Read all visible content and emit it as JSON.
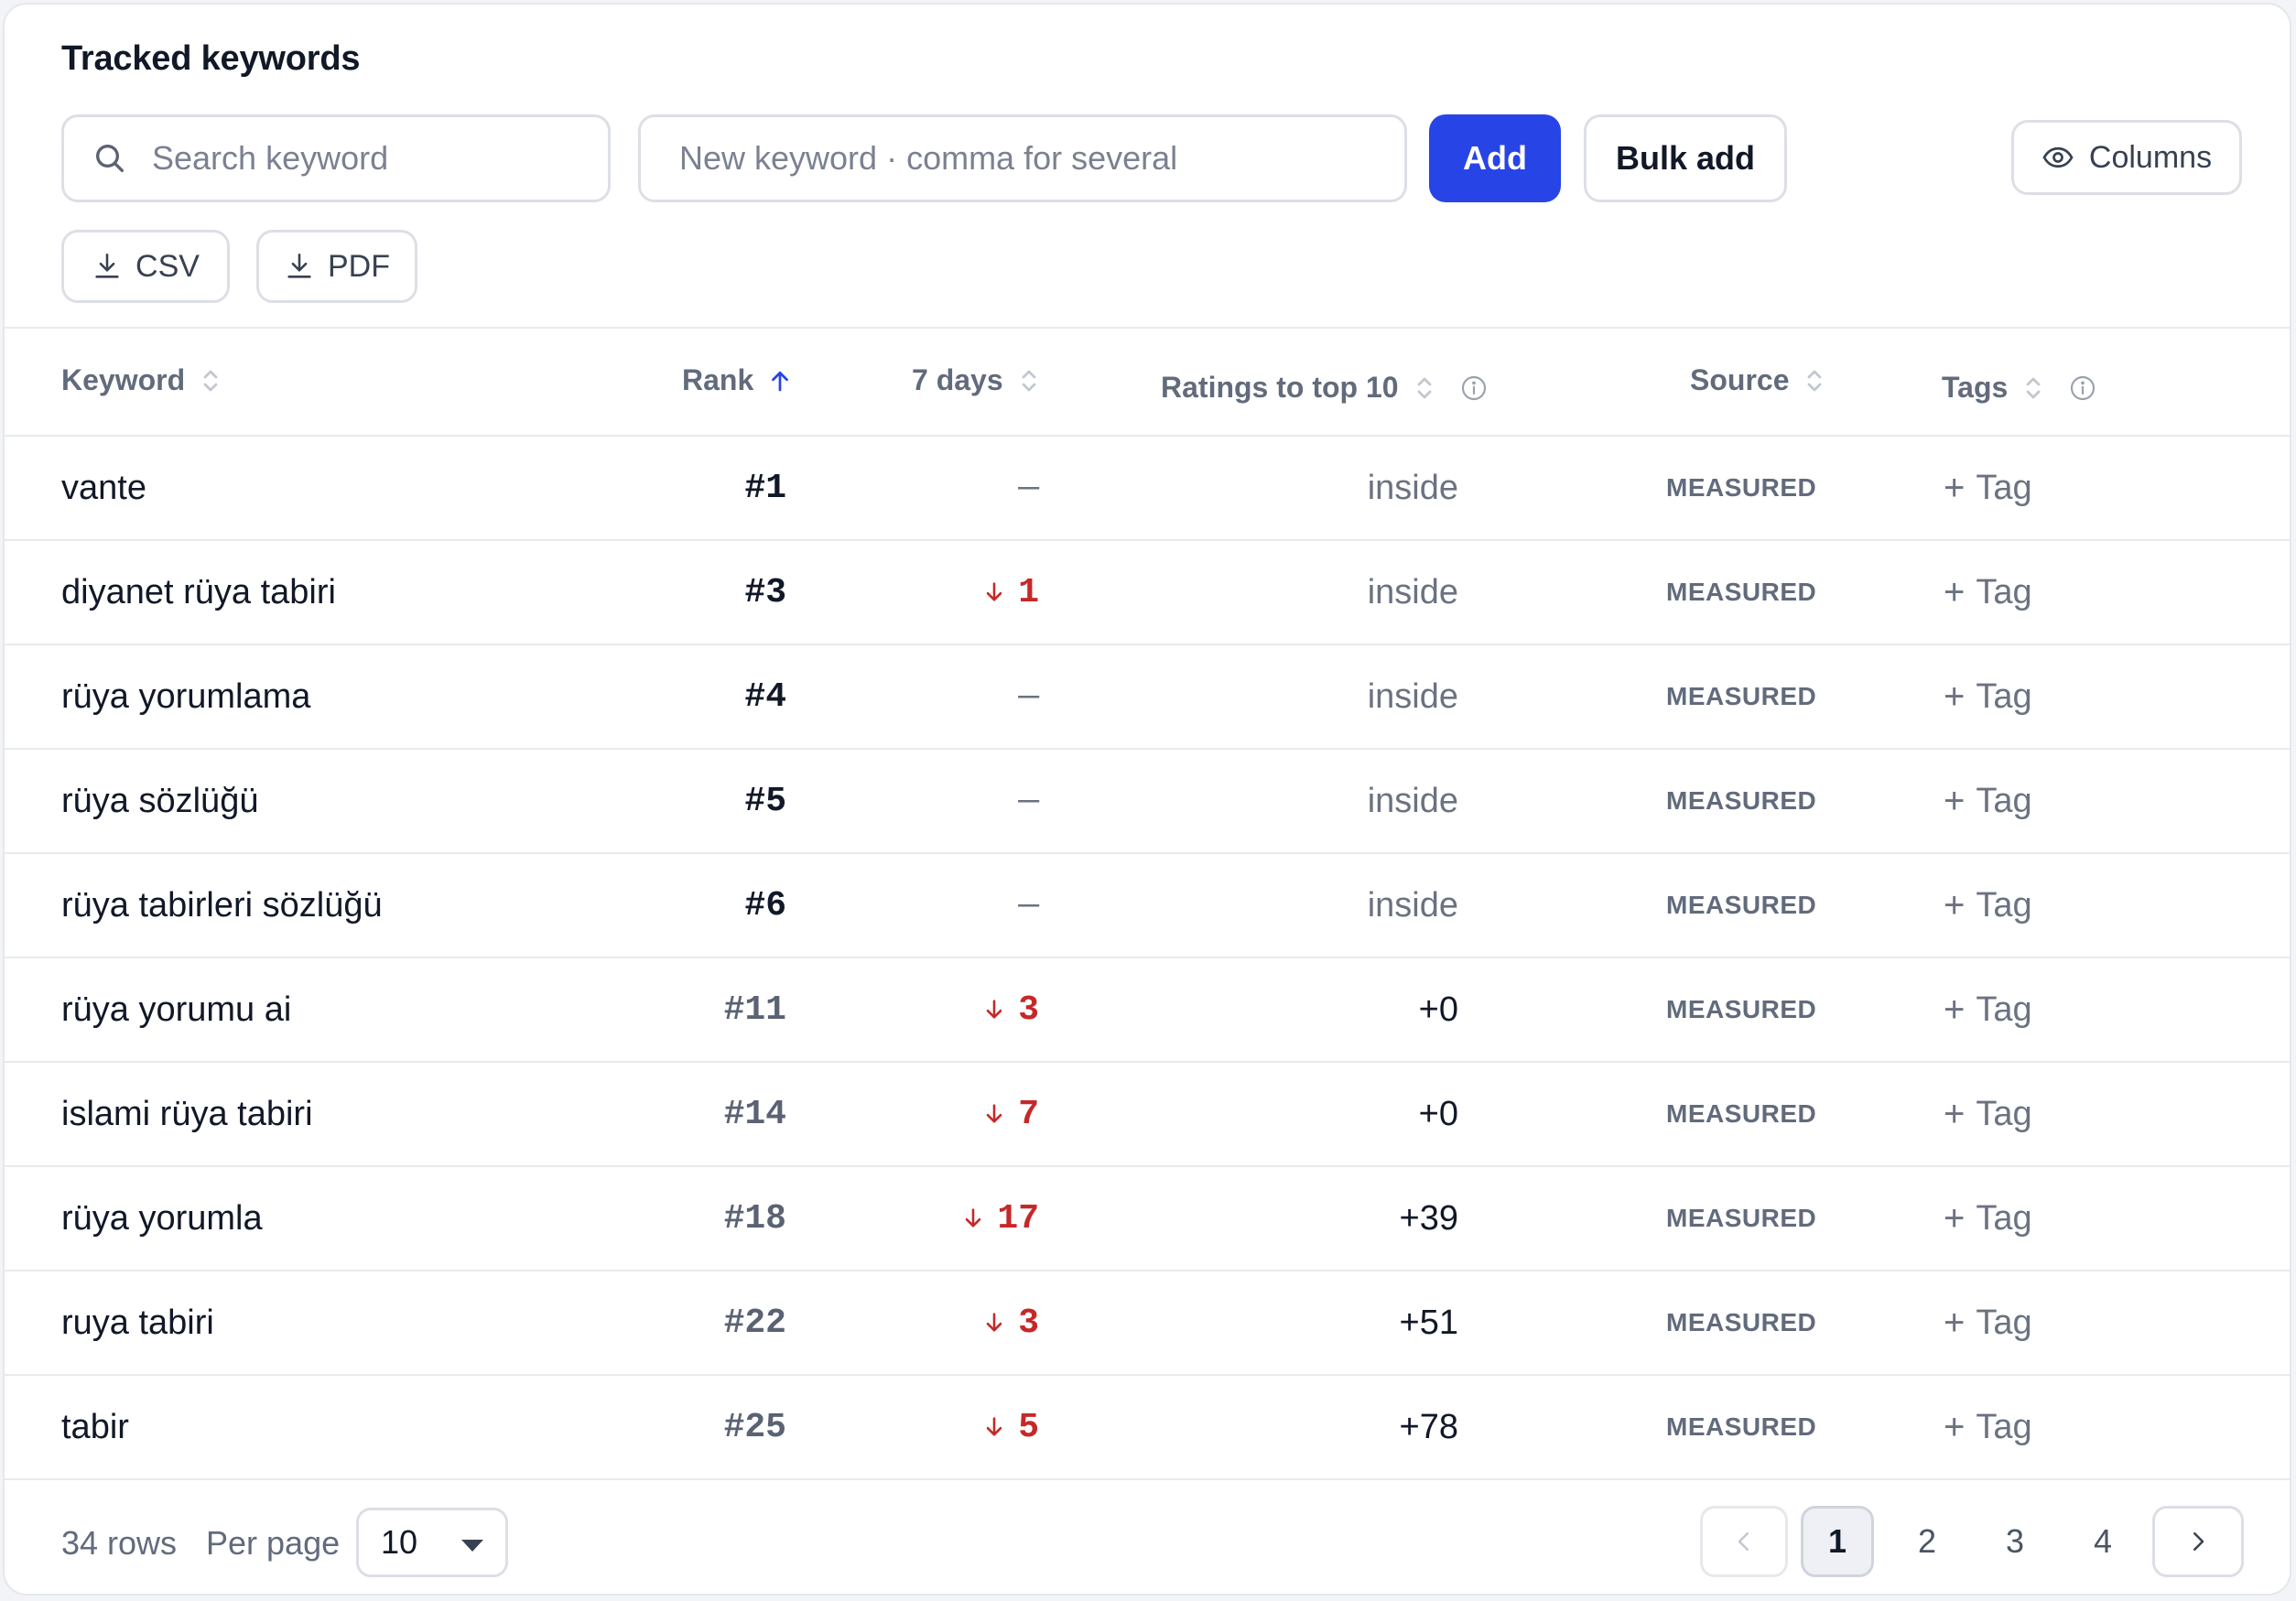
{
  "title": "Tracked keywords",
  "search": {
    "placeholder": "Search keyword"
  },
  "new_keyword": {
    "placeholder": "New keyword · comma for several"
  },
  "buttons": {
    "add": "Add",
    "bulk_add": "Bulk add",
    "columns": "Columns",
    "csv": "CSV",
    "pdf": "PDF"
  },
  "table": {
    "headers": {
      "keyword": "Keyword",
      "rank": "Rank",
      "days": "7 days",
      "ratings": "Ratings to top 10",
      "source": "Source",
      "tags": "Tags"
    },
    "rows": [
      {
        "keyword": "vante",
        "rank": "#1",
        "delta": "—",
        "ratings": "inside",
        "source": "MEASURED",
        "tag": "Tag"
      },
      {
        "keyword": "diyanet rüya tabiri",
        "rank": "#3",
        "delta": "1",
        "ratings": "inside",
        "source": "MEASURED",
        "tag": "Tag"
      },
      {
        "keyword": "rüya yorumlama",
        "rank": "#4",
        "delta": "—",
        "ratings": "inside",
        "source": "MEASURED",
        "tag": "Tag"
      },
      {
        "keyword": "rüya sözlüğü",
        "rank": "#5",
        "delta": "—",
        "ratings": "inside",
        "source": "MEASURED",
        "tag": "Tag"
      },
      {
        "keyword": "rüya tabirleri sözlüğü",
        "rank": "#6",
        "delta": "—",
        "ratings": "inside",
        "source": "MEASURED",
        "tag": "Tag"
      },
      {
        "keyword": "rüya yorumu ai",
        "rank": "#11",
        "delta": "3",
        "ratings": "+0",
        "source": "MEASURED",
        "tag": "Tag"
      },
      {
        "keyword": "islami rüya tabiri",
        "rank": "#14",
        "delta": "7",
        "ratings": "+0",
        "source": "MEASURED",
        "tag": "Tag"
      },
      {
        "keyword": "rüya yorumla",
        "rank": "#18",
        "delta": "17",
        "ratings": "+39",
        "source": "MEASURED",
        "tag": "Tag"
      },
      {
        "keyword": "ruya tabiri",
        "rank": "#22",
        "delta": "3",
        "ratings": "+51",
        "source": "MEASURED",
        "tag": "Tag"
      },
      {
        "keyword": "tabir",
        "rank": "#25",
        "delta": "5",
        "ratings": "+78",
        "source": "MEASURED",
        "tag": "Tag"
      }
    ]
  },
  "footer": {
    "rows_count": "34 rows",
    "per_page_label": "Per page",
    "per_page_value": "10",
    "pages": [
      "1",
      "2",
      "3",
      "4"
    ],
    "current_page": "1"
  },
  "colors": {
    "accent": "#2744e6",
    "down": "#c62828",
    "muted": "#626b7c"
  },
  "icons": {
    "search": "search-icon",
    "columns": "eye-icon",
    "export": "download-icon",
    "sort": "sort-icon",
    "sort_asc": "arrow-up-icon",
    "info": "info-icon",
    "down": "arrow-down-icon",
    "prev": "chevron-left-icon",
    "next": "chevron-right-icon"
  }
}
